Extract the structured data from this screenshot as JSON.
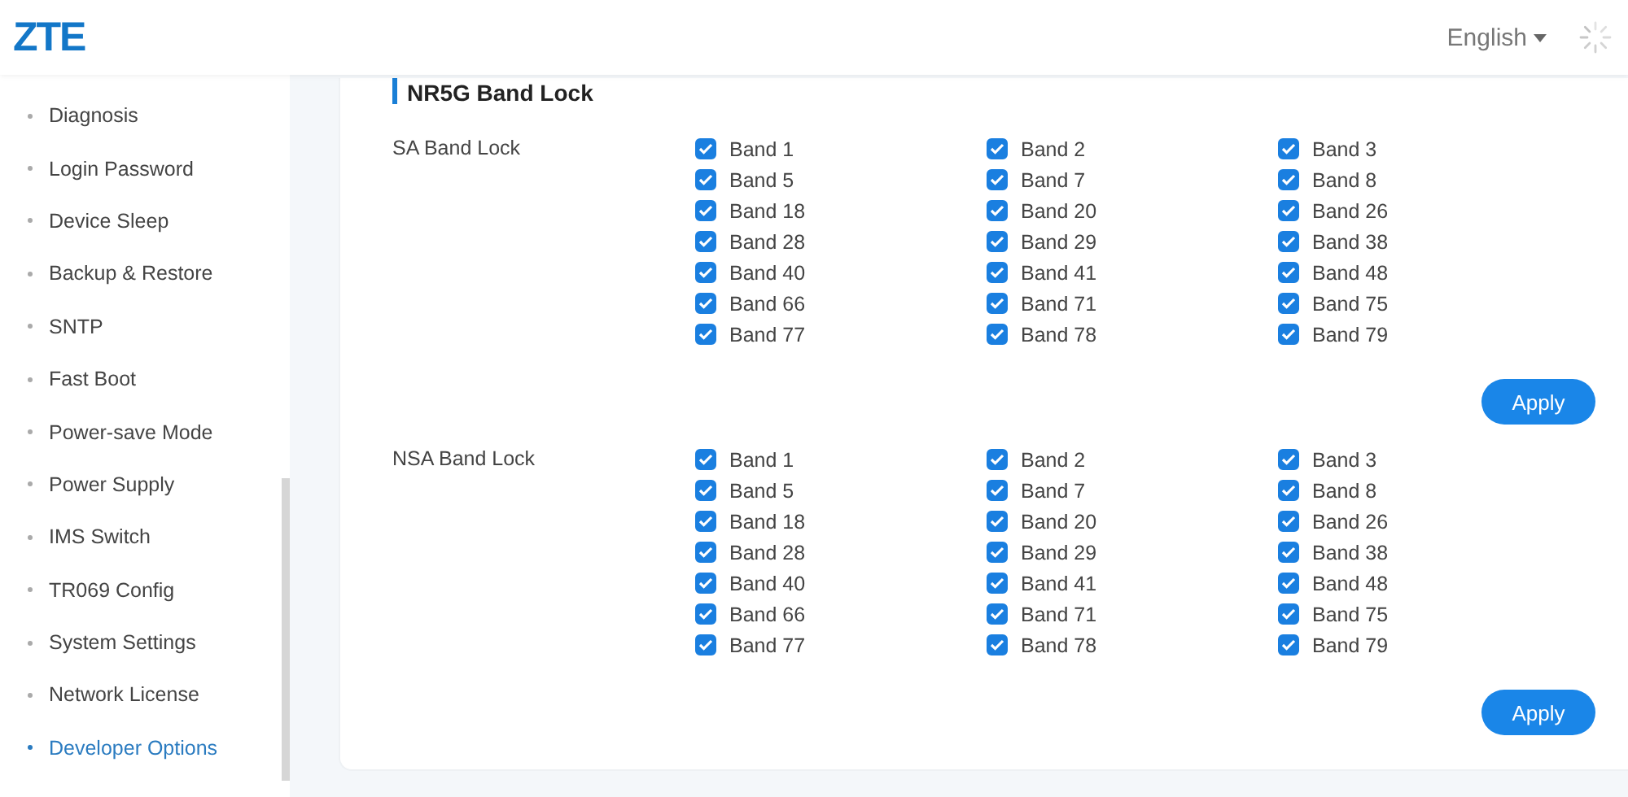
{
  "header": {
    "logo": "ZTE",
    "language": "English"
  },
  "sidebar": {
    "items": [
      {
        "label": "Diagnosis",
        "selected": false
      },
      {
        "label": "Login Password",
        "selected": false
      },
      {
        "label": "Device Sleep",
        "selected": false
      },
      {
        "label": "Backup & Restore",
        "selected": false
      },
      {
        "label": "SNTP",
        "selected": false
      },
      {
        "label": "Fast Boot",
        "selected": false
      },
      {
        "label": "Power-save Mode",
        "selected": false
      },
      {
        "label": "Power Supply",
        "selected": false
      },
      {
        "label": "IMS Switch",
        "selected": false
      },
      {
        "label": "TR069 Config",
        "selected": false
      },
      {
        "label": "System Settings",
        "selected": false
      },
      {
        "label": "Network License",
        "selected": false
      },
      {
        "label": "Developer Options",
        "selected": true
      }
    ]
  },
  "panel": {
    "title": "NR5G Band Lock",
    "sections": [
      {
        "label": "SA Band Lock",
        "button": "Apply",
        "bands": [
          {
            "label": "Band 1",
            "checked": true
          },
          {
            "label": "Band 2",
            "checked": true
          },
          {
            "label": "Band 3",
            "checked": true
          },
          {
            "label": "Band 5",
            "checked": true
          },
          {
            "label": "Band 7",
            "checked": true
          },
          {
            "label": "Band 8",
            "checked": true
          },
          {
            "label": "Band 18",
            "checked": true
          },
          {
            "label": "Band 20",
            "checked": true
          },
          {
            "label": "Band 26",
            "checked": true
          },
          {
            "label": "Band 28",
            "checked": true
          },
          {
            "label": "Band 29",
            "checked": true
          },
          {
            "label": "Band 38",
            "checked": true
          },
          {
            "label": "Band 40",
            "checked": true
          },
          {
            "label": "Band 41",
            "checked": true
          },
          {
            "label": "Band 48",
            "checked": true
          },
          {
            "label": "Band 66",
            "checked": true
          },
          {
            "label": "Band 71",
            "checked": true
          },
          {
            "label": "Band 75",
            "checked": true
          },
          {
            "label": "Band 77",
            "checked": true
          },
          {
            "label": "Band 78",
            "checked": true
          },
          {
            "label": "Band 79",
            "checked": true
          }
        ]
      },
      {
        "label": "NSA Band Lock",
        "button": "Apply",
        "bands": [
          {
            "label": "Band 1",
            "checked": true
          },
          {
            "label": "Band 2",
            "checked": true
          },
          {
            "label": "Band 3",
            "checked": true
          },
          {
            "label": "Band 5",
            "checked": true
          },
          {
            "label": "Band 7",
            "checked": true
          },
          {
            "label": "Band 8",
            "checked": true
          },
          {
            "label": "Band 18",
            "checked": true
          },
          {
            "label": "Band 20",
            "checked": true
          },
          {
            "label": "Band 26",
            "checked": true
          },
          {
            "label": "Band 28",
            "checked": true
          },
          {
            "label": "Band 29",
            "checked": true
          },
          {
            "label": "Band 38",
            "checked": true
          },
          {
            "label": "Band 40",
            "checked": true
          },
          {
            "label": "Band 41",
            "checked": true
          },
          {
            "label": "Band 48",
            "checked": true
          },
          {
            "label": "Band 66",
            "checked": true
          },
          {
            "label": "Band 71",
            "checked": true
          },
          {
            "label": "Band 75",
            "checked": true
          },
          {
            "label": "Band 77",
            "checked": true
          },
          {
            "label": "Band 78",
            "checked": true
          },
          {
            "label": "Band 79",
            "checked": true
          }
        ]
      }
    ]
  }
}
